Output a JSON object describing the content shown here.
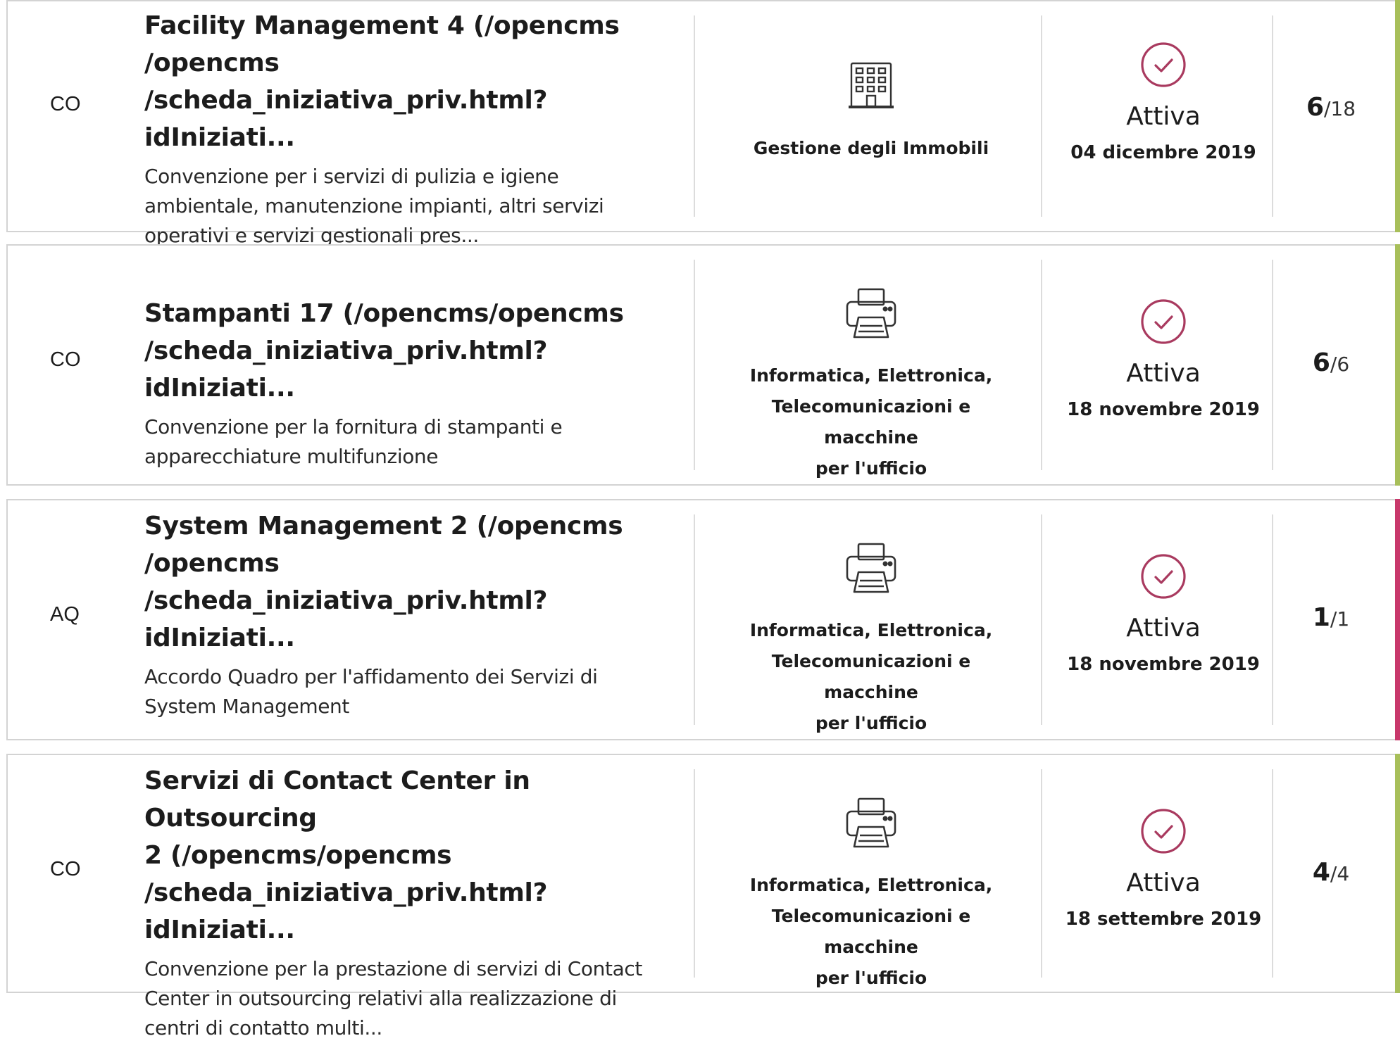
{
  "colors": {
    "accent_green": "#a8bf5a",
    "accent_pink": "#c8386b",
    "status_check": "#a93a5f"
  },
  "cards": [
    {
      "type": "CO",
      "title": "Facility Management 4 (/opencms /opencms /scheda_iniziativa_priv.html?idIniziati...",
      "title_lines": [
        "Facility Management 4 (/opencms",
        "/opencms",
        "/scheda_iniziativa_priv.html?idIniziati..."
      ],
      "description_lines": [
        "Convenzione per i servizi di pulizia e igiene",
        "ambientale, manutenzione impianti, altri servizi",
        "operativi e servizi gestionali pres..."
      ],
      "category_icon": "building-icon",
      "category_lines": [
        "Gestione degli Immobili"
      ],
      "status": "Attiva",
      "status_icon": "check-circle-icon",
      "date": "04 dicembre 2019",
      "count": "6",
      "total": "/18",
      "accent": "green"
    },
    {
      "type": "CO",
      "title": "Stampanti 17 (/opencms/opencms /scheda_iniziativa_priv.html?idIniziati...",
      "title_lines": [
        "Stampanti 17 (/opencms/opencms",
        "/scheda_iniziativa_priv.html?idIniziati..."
      ],
      "description_lines": [
        "Convenzione per la fornitura di stampanti e",
        "apparecchiature multifunzione"
      ],
      "category_icon": "printer-icon",
      "category_lines": [
        "Informatica, Elettronica,",
        "Telecomunicazioni e macchine",
        "per l'ufficio"
      ],
      "status": "Attiva",
      "status_icon": "check-circle-icon",
      "date": "18 novembre 2019",
      "count": "6",
      "total": "/6",
      "accent": "green"
    },
    {
      "type": "AQ",
      "title": "System Management 2 (/opencms /opencms /scheda_iniziativa_priv.html?idIniziati...",
      "title_lines": [
        "System Management 2 (/opencms",
        "/opencms",
        "/scheda_iniziativa_priv.html?idIniziati..."
      ],
      "description_lines": [
        "Accordo Quadro per l'affidamento dei Servizi di",
        "System Management"
      ],
      "category_icon": "printer-icon",
      "category_lines": [
        "Informatica, Elettronica,",
        "Telecomunicazioni e macchine",
        "per l'ufficio"
      ],
      "status": "Attiva",
      "status_icon": "check-circle-icon",
      "date": "18 novembre 2019",
      "count": "1",
      "total": "/1",
      "accent": "pink"
    },
    {
      "type": "CO",
      "title": "Servizi di Contact Center in Outsourcing 2 (/opencms/opencms /scheda_iniziativa_priv.html?idIniziati...",
      "title_lines": [
        "Servizi di Contact Center in Outsourcing",
        "2 (/opencms/opencms",
        "/scheda_iniziativa_priv.html?idIniziati..."
      ],
      "description_lines": [
        "Convenzione per la prestazione di servizi di Contact",
        "Center in outsourcing relativi alla realizzazione di",
        "centri di contatto multi..."
      ],
      "category_icon": "printer-icon",
      "category_lines": [
        "Informatica, Elettronica,",
        "Telecomunicazioni e macchine",
        "per l'ufficio"
      ],
      "status": "Attiva",
      "status_icon": "check-circle-icon",
      "date": "18 settembre 2019",
      "count": "4",
      "total": "/4",
      "accent": "green"
    }
  ]
}
